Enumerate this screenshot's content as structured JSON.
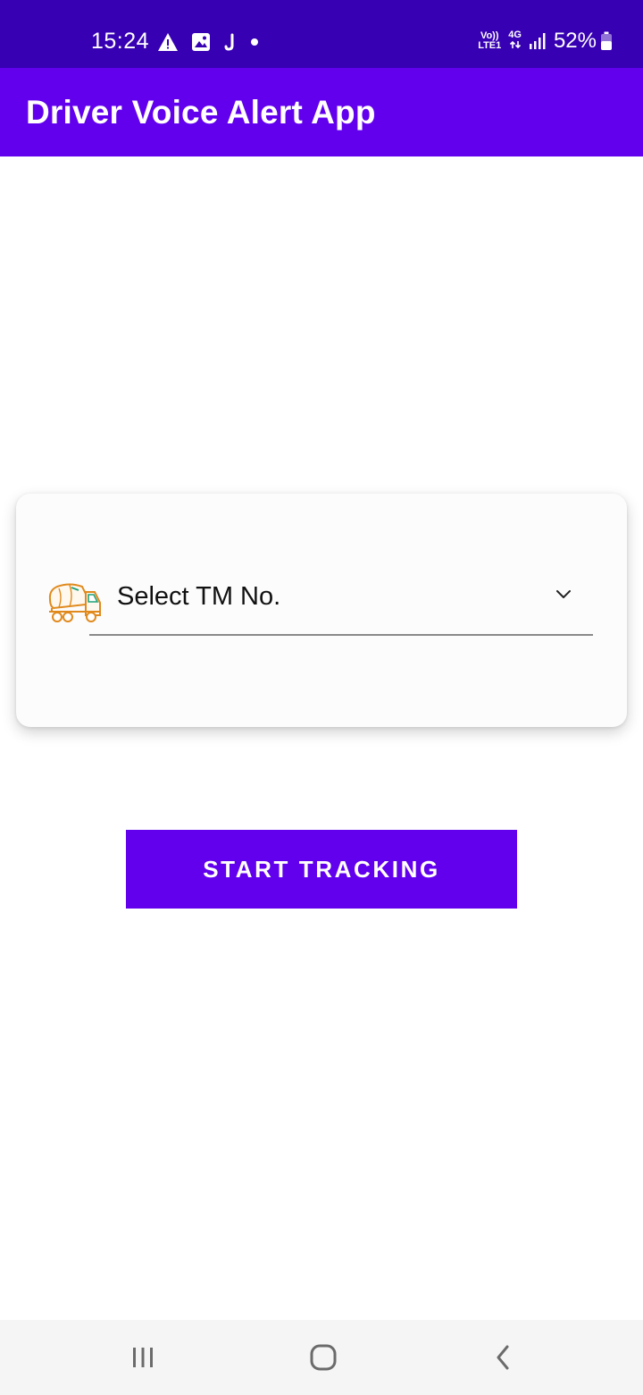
{
  "status_bar": {
    "time": "15:24",
    "icons_left": [
      "warning-icon",
      "gallery-icon",
      "app-notification-icon",
      "dot-icon"
    ],
    "volte_line1": "Vo))",
    "volte_line2": "LTE1",
    "network_type": "4G",
    "battery_percent": "52%",
    "background_color": "#3700B3"
  },
  "app_bar": {
    "title": "Driver Voice Alert App",
    "background_color": "#6200EE"
  },
  "card": {
    "icon": "concrete-mixer-truck-icon",
    "select": {
      "placeholder": "Select TM No.",
      "icon": "chevron-down-icon"
    }
  },
  "actions": {
    "start_tracking_label": "START TRACKING",
    "button_color": "#6200EE"
  },
  "nav_bar": {
    "items": [
      "recent-apps-icon",
      "home-icon",
      "back-icon"
    ]
  }
}
